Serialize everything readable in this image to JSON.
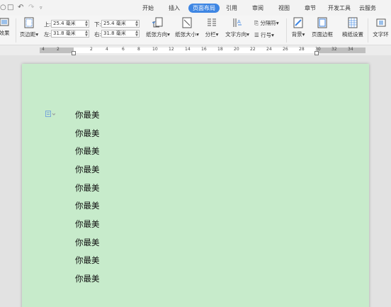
{
  "menu": {
    "tabs": [
      "开始",
      "插入",
      "页面布局",
      "引用",
      "审阅",
      "视图",
      "章节",
      "开发工具",
      "云服务"
    ],
    "active_tab": "页面布局"
  },
  "ribbon": {
    "effect_label": "效果",
    "margins_label": "页边距",
    "top_label": "上:",
    "top_value": "25.4 毫米",
    "bottom_label": "下:",
    "bottom_value": "25.4 毫米",
    "left_label": "左:",
    "left_value": "31.8 毫米",
    "right_label": "右:",
    "right_value": "31.8 毫米",
    "orientation_label": "纸张方向",
    "size_label": "纸张大小",
    "columns_label": "分栏",
    "text_direction_label": "文字方向",
    "separator_label": "分隔符",
    "line_number_label": "行号",
    "background_label": "背景",
    "page_border_label": "页面边框",
    "manuscript_label": "稿纸设置",
    "wrap_label": "文字环"
  },
  "ruler": {
    "numbers": [
      "4",
      "2",
      "2",
      "4",
      "6",
      "8",
      "10",
      "12",
      "14",
      "16",
      "18",
      "20",
      "22",
      "24",
      "26",
      "28",
      "30",
      "32",
      "34"
    ]
  },
  "document": {
    "lines": [
      "你最美",
      "你最美",
      "你最美",
      "你最美",
      "你最美",
      "你最美",
      "你最美",
      "你最美",
      "你最美",
      "你最美"
    ]
  },
  "colors": {
    "page_background": "#c7ebcb",
    "active_tab": "#3e86e3"
  }
}
